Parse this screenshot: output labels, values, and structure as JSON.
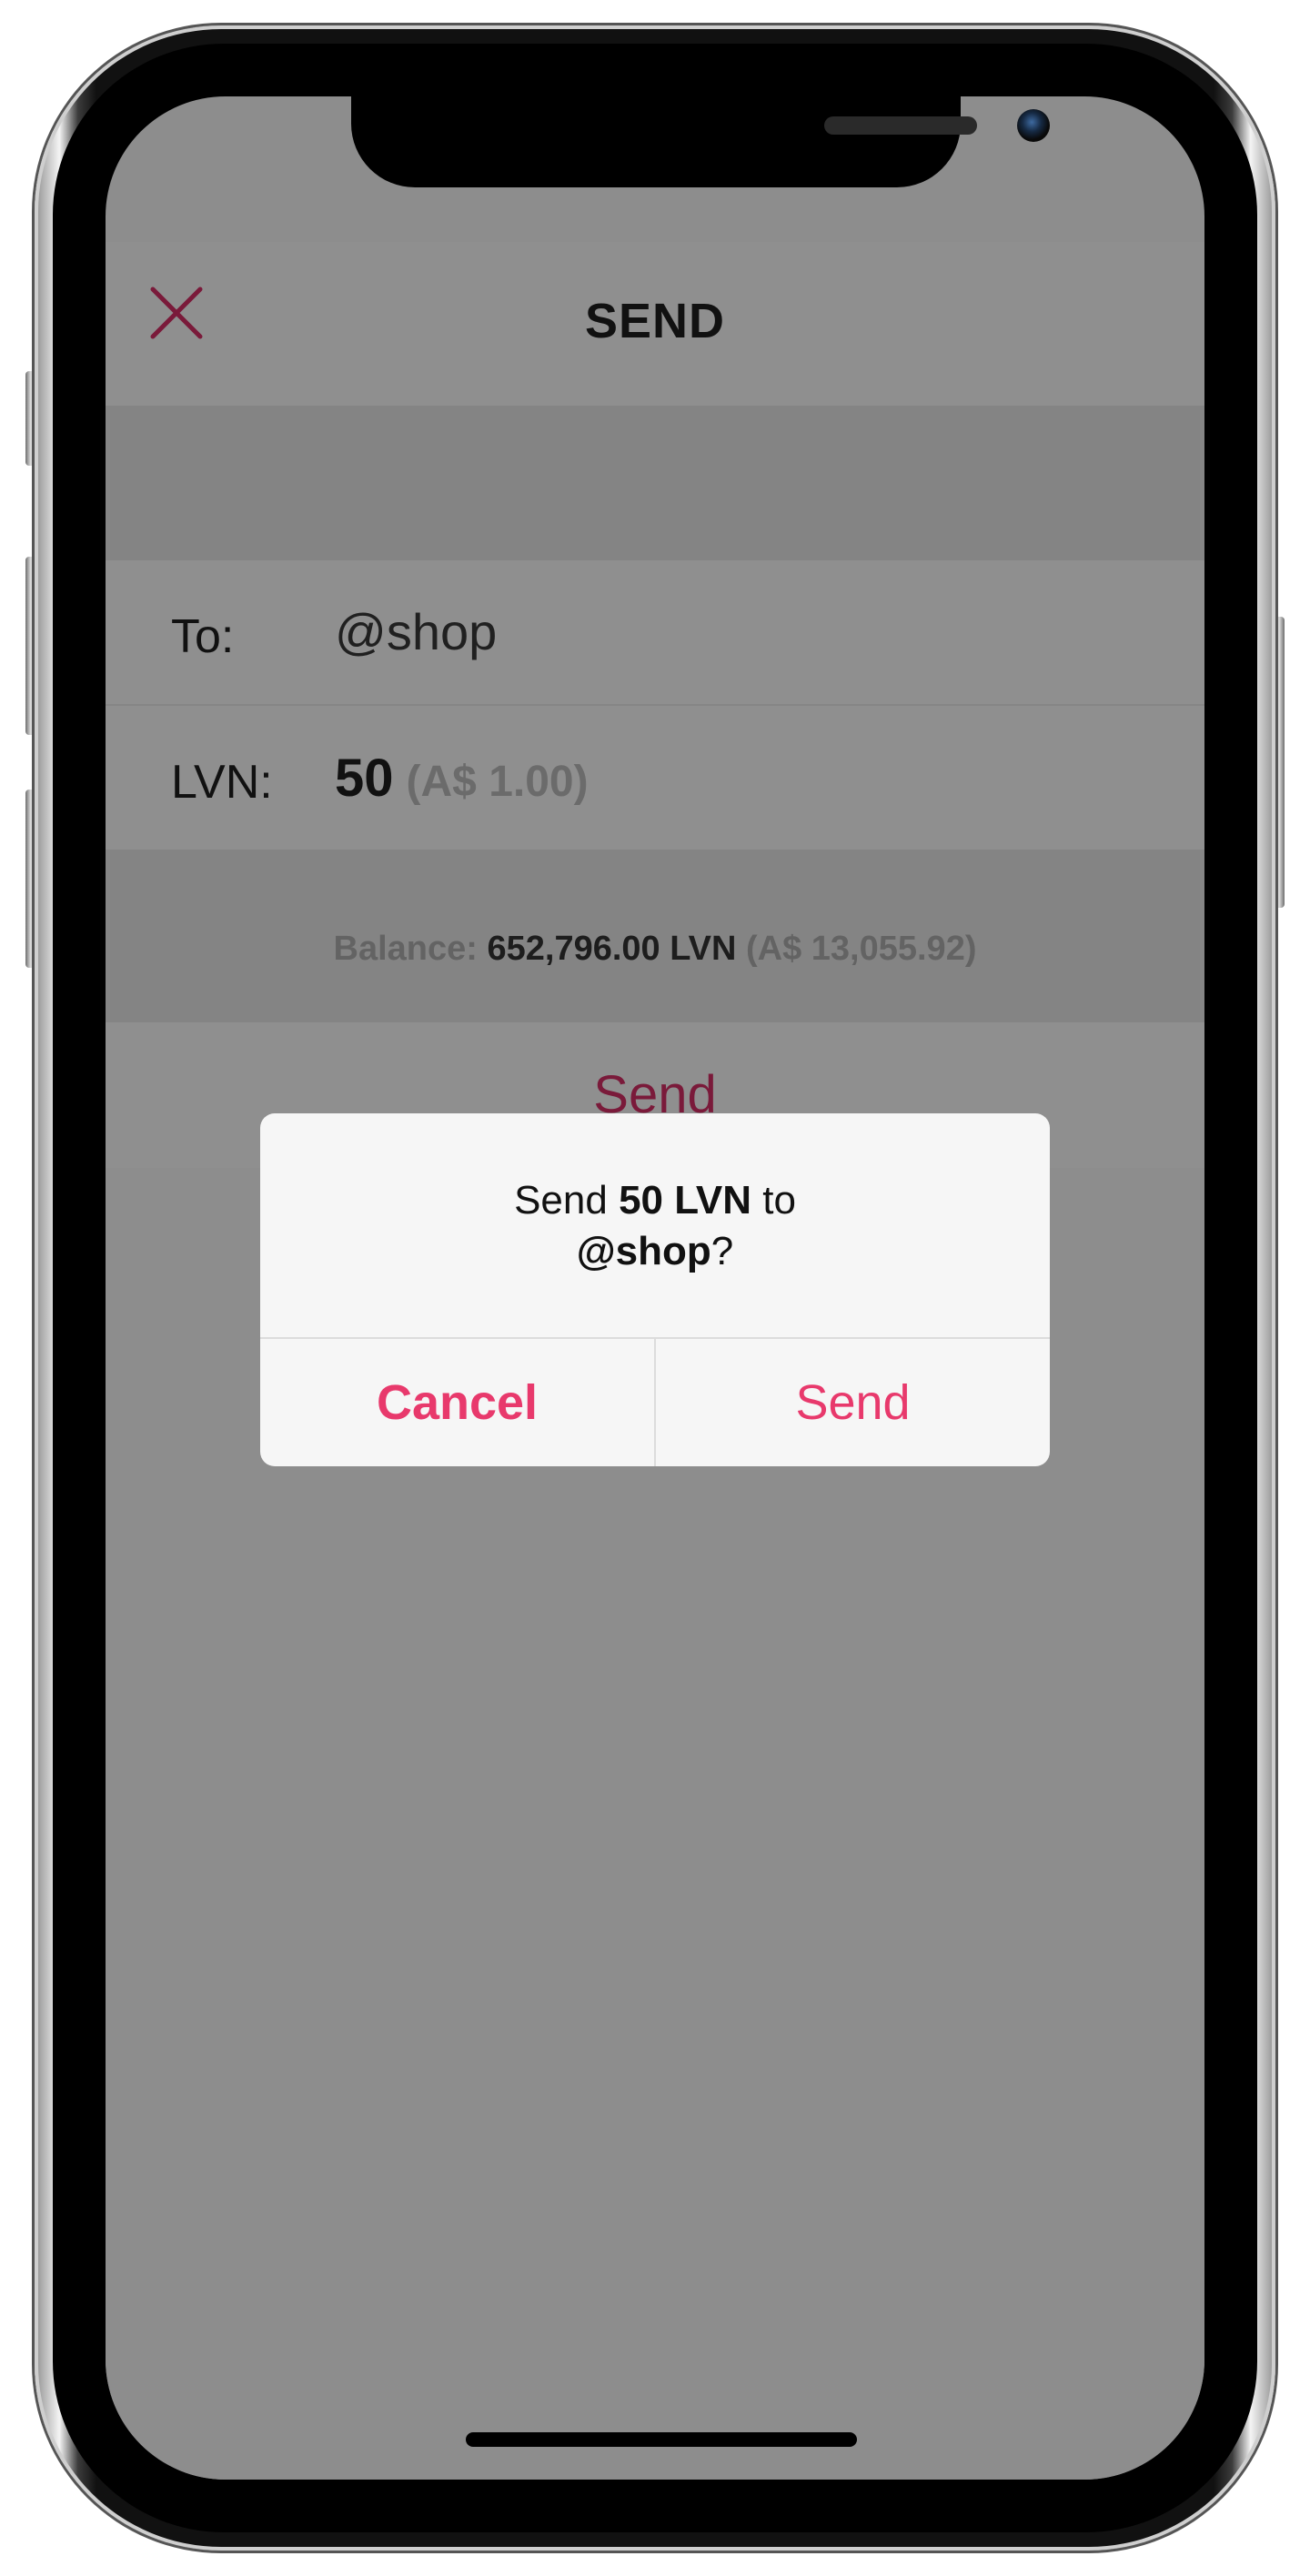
{
  "nav": {
    "title": "SEND"
  },
  "form": {
    "to_label": "To:",
    "to_value": "@shop",
    "amount_label": "LVN:",
    "amount_value": "50",
    "amount_fiat": "(A$ 1.00)"
  },
  "balance": {
    "label": "Balance:",
    "amount": "652,796.00 LVN",
    "fiat": "(A$ 13,055.92)"
  },
  "send_button_label": "Send",
  "alert": {
    "prefix": "Send",
    "amount": "50 LVN",
    "middle": "to",
    "recipient": "@shop",
    "suffix": "?",
    "cancel_label": "Cancel",
    "confirm_label": "Send"
  },
  "colors": {
    "accent": "#e8396c",
    "accent_dimmed": "#7a1a3a",
    "overlay_gray": "#8d8d8d"
  },
  "icons": [
    "close-icon"
  ]
}
